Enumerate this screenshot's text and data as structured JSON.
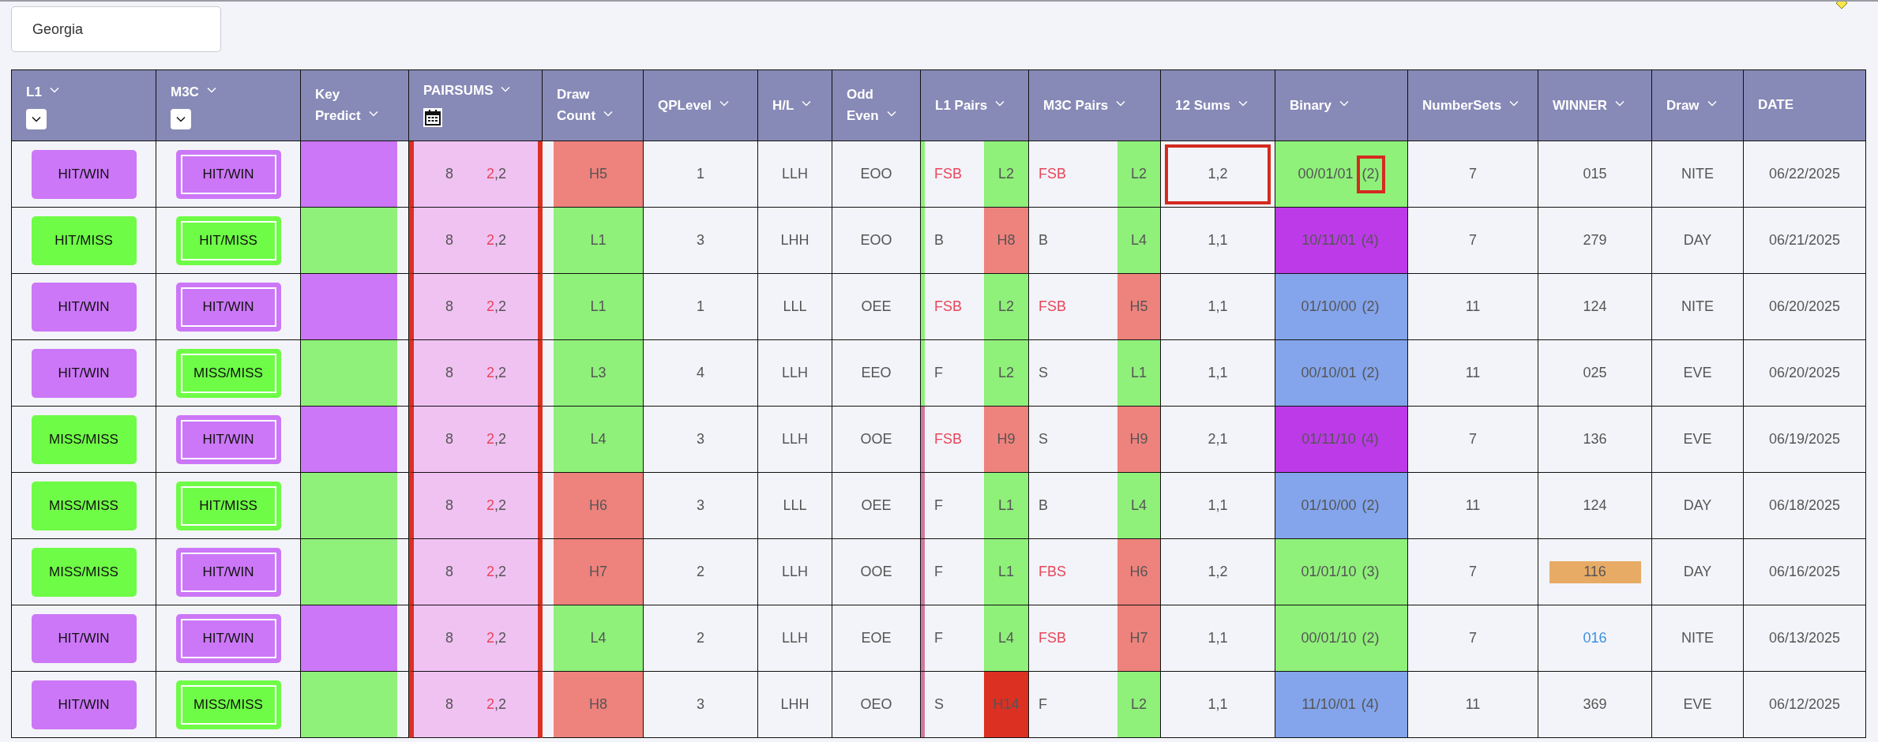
{
  "search": {
    "value": "Georgia"
  },
  "columns": [
    {
      "label": "L1",
      "menu": true,
      "kind": "dropdown"
    },
    {
      "label": "M3C",
      "menu": true,
      "kind": "dropdown"
    },
    {
      "label": "Key\nPredict",
      "menu": true
    },
    {
      "label": "PAIRSUMS",
      "menu": true,
      "kind": "calendar"
    },
    {
      "label": "Draw\nCount",
      "menu": true
    },
    {
      "label": "QPLevel",
      "menu": true
    },
    {
      "label": "H/L",
      "menu": true
    },
    {
      "label": "Odd\nEven",
      "menu": true
    },
    {
      "label": "L1 Pairs",
      "menu": true
    },
    {
      "label": "M3C Pairs",
      "menu": true
    },
    {
      "label": "12 Sums",
      "menu": true
    },
    {
      "label": "Binary",
      "menu": true
    },
    {
      "label": "NumberSets",
      "menu": true
    },
    {
      "label": "WINNER",
      "menu": true
    },
    {
      "label": "Draw",
      "menu": true
    },
    {
      "label": "DATE",
      "menu": false
    }
  ],
  "rows": [
    {
      "l1": {
        "text": "HIT/WIN",
        "color": "#cc77f7"
      },
      "m3c": {
        "text": "HIT/WIN",
        "color": "#cc77f7"
      },
      "key_predict": {
        "color": "#cc77f7"
      },
      "pairsum": "8",
      "pair_lead": "2",
      "pair_rest": ",2",
      "draw_count": {
        "text": "H5",
        "color": "#ee827c"
      },
      "qp_level": "1",
      "hl": "LLH",
      "odd_even": "EOO",
      "edge": {
        "color": "#8ff07a"
      },
      "l1_pairs": {
        "letters": "FSB",
        "alert": true,
        "tag": "L2",
        "color": "#8ff07a"
      },
      "m3c_pairs": {
        "letters": "FSB",
        "alert": true,
        "tag": "L2",
        "color": "#8ff07a"
      },
      "sums": {
        "text": "1,2",
        "boxed": true
      },
      "binary": {
        "pattern": "00/01/01",
        "count": "(2)",
        "count_boxed": true,
        "color": "#8ff07a"
      },
      "number_sets": "7",
      "winner": {
        "text": "015",
        "kind": "plain"
      },
      "draw": "NITE",
      "date": "06/22/2025"
    },
    {
      "l1": {
        "text": "HIT/MISS",
        "color": "#6efc46"
      },
      "m3c": {
        "text": "HIT/MISS",
        "color": "#6efc46"
      },
      "key_predict": {
        "color": "#8ff07a"
      },
      "pairsum": "8",
      "pair_lead": "2",
      "pair_rest": ",2",
      "draw_count": {
        "text": "L1",
        "color": "#8ff07a"
      },
      "qp_level": "3",
      "hl": "LHH",
      "odd_even": "EOO",
      "edge": {
        "color": "#8ff07a"
      },
      "l1_pairs": {
        "letters": "B",
        "alert": false,
        "tag": "H8",
        "color": "#ee827c"
      },
      "m3c_pairs": {
        "letters": "B",
        "alert": false,
        "tag": "L4",
        "color": "#8ff07a"
      },
      "sums": {
        "text": "1,1",
        "boxed": false
      },
      "binary": {
        "pattern": "10/11/01",
        "count": "(4)",
        "count_boxed": false,
        "color": "#bd3ae8"
      },
      "number_sets": "7",
      "winner": {
        "text": "279",
        "kind": "plain"
      },
      "draw": "DAY",
      "date": "06/21/2025"
    },
    {
      "l1": {
        "text": "HIT/WIN",
        "color": "#cc77f7"
      },
      "m3c": {
        "text": "HIT/WIN",
        "color": "#cc77f7"
      },
      "key_predict": {
        "color": "#cc77f7"
      },
      "pairsum": "8",
      "pair_lead": "2",
      "pair_rest": ",2",
      "draw_count": {
        "text": "L1",
        "color": "#8ff07a"
      },
      "qp_level": "1",
      "hl": "LLL",
      "odd_even": "OEE",
      "edge": {
        "color": "#8ff07a"
      },
      "l1_pairs": {
        "letters": "FSB",
        "alert": true,
        "tag": "L2",
        "color": "#8ff07a"
      },
      "m3c_pairs": {
        "letters": "FSB",
        "alert": true,
        "tag": "H5",
        "color": "#ee827c"
      },
      "sums": {
        "text": "1,1",
        "boxed": false
      },
      "binary": {
        "pattern": "01/10/00",
        "count": "(2)",
        "count_boxed": false,
        "color": "#84a5ec"
      },
      "number_sets": "11",
      "winner": {
        "text": "124",
        "kind": "plain"
      },
      "draw": "NITE",
      "date": "06/20/2025"
    },
    {
      "l1": {
        "text": "HIT/WIN",
        "color": "#cc77f7"
      },
      "m3c": {
        "text": "MISS/MISS",
        "color": "#6efc46"
      },
      "key_predict": {
        "color": "#8ff07a"
      },
      "pairsum": "8",
      "pair_lead": "2",
      "pair_rest": ",2",
      "draw_count": {
        "text": "L3",
        "color": "#8ff07a"
      },
      "qp_level": "4",
      "hl": "LLH",
      "odd_even": "EEO",
      "edge": {
        "color": "#8ff07a"
      },
      "l1_pairs": {
        "letters": "F",
        "alert": false,
        "tag": "L2",
        "color": "#8ff07a"
      },
      "m3c_pairs": {
        "letters": "S",
        "alert": false,
        "tag": "L1",
        "color": "#8ff07a"
      },
      "sums": {
        "text": "1,1",
        "boxed": false
      },
      "binary": {
        "pattern": "00/10/01",
        "count": "(2)",
        "count_boxed": false,
        "color": "#84a5ec"
      },
      "number_sets": "11",
      "winner": {
        "text": "025",
        "kind": "plain"
      },
      "draw": "EVE",
      "date": "06/20/2025"
    },
    {
      "l1": {
        "text": "MISS/MISS",
        "color": "#6efc46"
      },
      "m3c": {
        "text": "HIT/WIN",
        "color": "#cc77f7"
      },
      "key_predict": {
        "color": "#cc77f7"
      },
      "pairsum": "8",
      "pair_lead": "2",
      "pair_rest": ",2",
      "draw_count": {
        "text": "L4",
        "color": "#8ff07a"
      },
      "qp_level": "3",
      "hl": "LLH",
      "odd_even": "OOE",
      "edge": {
        "color": "#d07a9a"
      },
      "l1_pairs": {
        "letters": "FSB",
        "alert": true,
        "tag": "H9",
        "color": "#ee827c"
      },
      "m3c_pairs": {
        "letters": "S",
        "alert": false,
        "tag": "H9",
        "color": "#ee827c"
      },
      "sums": {
        "text": "2,1",
        "boxed": false
      },
      "binary": {
        "pattern": "01/11/10",
        "count": "(4)",
        "count_boxed": false,
        "color": "#bd3ae8"
      },
      "number_sets": "7",
      "winner": {
        "text": "136",
        "kind": "plain"
      },
      "draw": "EVE",
      "date": "06/19/2025"
    },
    {
      "l1": {
        "text": "MISS/MISS",
        "color": "#6efc46"
      },
      "m3c": {
        "text": "HIT/MISS",
        "color": "#6efc46"
      },
      "key_predict": {
        "color": "#8ff07a"
      },
      "pairsum": "8",
      "pair_lead": "2",
      "pair_rest": ",2",
      "draw_count": {
        "text": "H6",
        "color": "#ee827c"
      },
      "qp_level": "3",
      "hl": "LLL",
      "odd_even": "OEE",
      "edge": {
        "color": "#d07a9a"
      },
      "l1_pairs": {
        "letters": "F",
        "alert": false,
        "tag": "L1",
        "color": "#8ff07a"
      },
      "m3c_pairs": {
        "letters": "B",
        "alert": false,
        "tag": "L4",
        "color": "#8ff07a"
      },
      "sums": {
        "text": "1,1",
        "boxed": false
      },
      "binary": {
        "pattern": "01/10/00",
        "count": "(2)",
        "count_boxed": false,
        "color": "#84a5ec"
      },
      "number_sets": "11",
      "winner": {
        "text": "124",
        "kind": "plain"
      },
      "draw": "DAY",
      "date": "06/18/2025"
    },
    {
      "l1": {
        "text": "MISS/MISS",
        "color": "#6efc46"
      },
      "m3c": {
        "text": "HIT/WIN",
        "color": "#cc77f7"
      },
      "key_predict": {
        "color": "#8ff07a"
      },
      "pairsum": "8",
      "pair_lead": "2",
      "pair_rest": ",2",
      "draw_count": {
        "text": "H7",
        "color": "#ee827c"
      },
      "qp_level": "2",
      "hl": "LLH",
      "odd_even": "OOE",
      "edge": {
        "color": "#d07a9a"
      },
      "l1_pairs": {
        "letters": "F",
        "alert": false,
        "tag": "L1",
        "color": "#8ff07a"
      },
      "m3c_pairs": {
        "letters": "FBS",
        "alert": true,
        "tag": "H6",
        "color": "#ee827c"
      },
      "sums": {
        "text": "1,2",
        "boxed": false
      },
      "binary": {
        "pattern": "01/01/10",
        "count": "(3)",
        "count_boxed": false,
        "color": "#8ff07a"
      },
      "number_sets": "7",
      "winner": {
        "text": "116",
        "kind": "highlight"
      },
      "draw": "DAY",
      "date": "06/16/2025"
    },
    {
      "l1": {
        "text": "HIT/WIN",
        "color": "#cc77f7"
      },
      "m3c": {
        "text": "HIT/WIN",
        "color": "#cc77f7"
      },
      "key_predict": {
        "color": "#cc77f7"
      },
      "pairsum": "8",
      "pair_lead": "2",
      "pair_rest": ",2",
      "draw_count": {
        "text": "L4",
        "color": "#8ff07a"
      },
      "qp_level": "2",
      "hl": "LLH",
      "odd_even": "EOE",
      "edge": {
        "color": "#d07a9a"
      },
      "l1_pairs": {
        "letters": "F",
        "alert": false,
        "tag": "L4",
        "color": "#8ff07a"
      },
      "m3c_pairs": {
        "letters": "FSB",
        "alert": true,
        "tag": "H7",
        "color": "#ee827c"
      },
      "sums": {
        "text": "1,1",
        "boxed": false
      },
      "binary": {
        "pattern": "00/01/10",
        "count": "(2)",
        "count_boxed": false,
        "color": "#8ff07a"
      },
      "number_sets": "7",
      "winner": {
        "text": "016",
        "kind": "link"
      },
      "draw": "NITE",
      "date": "06/13/2025"
    },
    {
      "l1": {
        "text": "HIT/WIN",
        "color": "#cc77f7"
      },
      "m3c": {
        "text": "MISS/MISS",
        "color": "#6efc46"
      },
      "key_predict": {
        "color": "#8ff07a"
      },
      "pairsum": "8",
      "pair_lead": "2",
      "pair_rest": ",2",
      "draw_count": {
        "text": "H8",
        "color": "#ee827c"
      },
      "qp_level": "3",
      "hl": "LHH",
      "odd_even": "OEO",
      "edge": {
        "color": "#d07a9a"
      },
      "l1_pairs": {
        "letters": "S",
        "alert": false,
        "tag": "H14",
        "color": "#dc3022"
      },
      "m3c_pairs": {
        "letters": "F",
        "alert": false,
        "tag": "L2",
        "color": "#8ff07a"
      },
      "sums": {
        "text": "1,1",
        "boxed": false
      },
      "binary": {
        "pattern": "11/10/01",
        "count": "(4)",
        "count_boxed": false,
        "color": "#84a5ec"
      },
      "number_sets": "11",
      "winner": {
        "text": "369",
        "kind": "plain"
      },
      "draw": "EVE",
      "date": "06/12/2025"
    }
  ]
}
